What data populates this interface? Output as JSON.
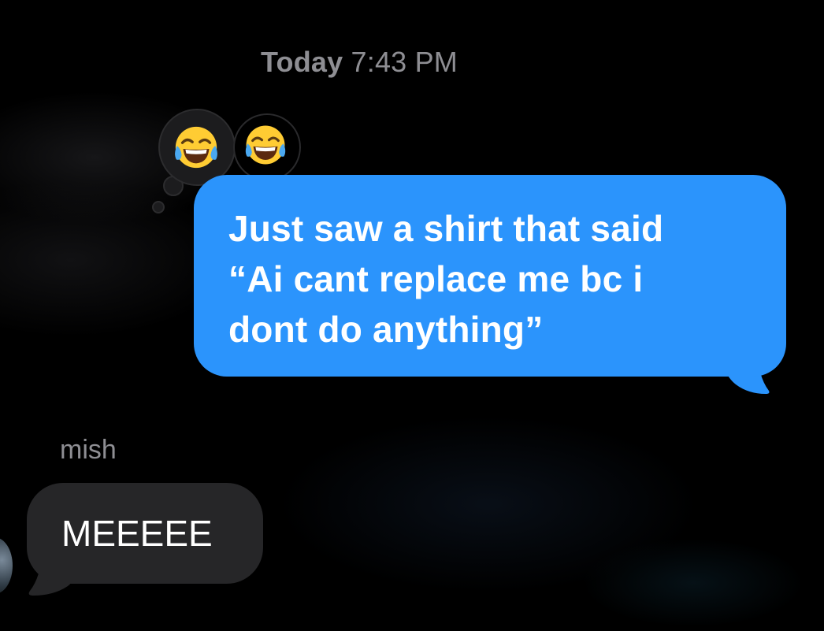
{
  "conversation": {
    "timestamp_day": "Today",
    "timestamp_time": "7:43 PM",
    "tapback": {
      "icon": "face-with-tears-of-joy-icon",
      "count": 2
    },
    "messages": [
      {
        "direction": "outgoing",
        "lines": [
          "Just saw a shirt that said",
          "“Ai cant replace me bc i",
          "dont do anything”"
        ]
      },
      {
        "direction": "incoming",
        "sender": "mish",
        "text": "MEEEEE"
      }
    ],
    "colors": {
      "outgoing_bubble": "#2b94fc",
      "incoming_bubble": "#262628",
      "meta_text": "#8e8e93",
      "background": "#000000"
    }
  }
}
